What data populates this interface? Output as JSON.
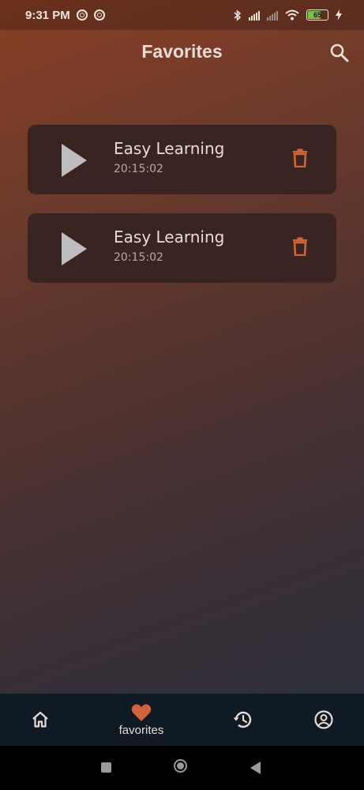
{
  "status_bar": {
    "time": "9:31 PM",
    "battery": "65"
  },
  "header": {
    "title": "Favorites"
  },
  "favorites": [
    {
      "title": "Easy Learning",
      "time": "20:15:02"
    },
    {
      "title": "Easy Learning",
      "time": "20:15:02"
    }
  ],
  "bottom_nav": {
    "items": [
      {
        "icon": "home-icon",
        "label": ""
      },
      {
        "icon": "heart-icon",
        "label": "favorites",
        "active": true
      },
      {
        "icon": "history-icon",
        "label": ""
      },
      {
        "icon": "account-icon",
        "label": ""
      }
    ]
  },
  "colors": {
    "accent": "#d2623a",
    "card": "#3a2421",
    "nav_bg": "#0f1a24"
  }
}
